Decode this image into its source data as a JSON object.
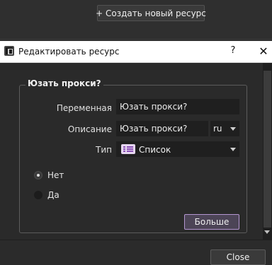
{
  "toolbar": {
    "create_resource_label": "+ Создать новый ресурс"
  },
  "dialog": {
    "title": "Редактировать ресурс",
    "help_glyph": "?",
    "close_glyph": "✕",
    "group_title": "Юзать прокси?",
    "variable_label": "Переменная",
    "variable_value": "Юзать прокси?",
    "description_label": "Описание",
    "description_value": "Юзать прокси?",
    "language_value": "ru",
    "type_label": "Тип",
    "type_value": "Список",
    "options": [
      {
        "label": "Нет",
        "selected": true
      },
      {
        "label": "Да",
        "selected": false
      }
    ],
    "more_button": "Больше"
  },
  "footer": {
    "close_button": "Close"
  },
  "colors": {
    "accent_border": "#b496d1",
    "accent_bg": "#4c4456",
    "dark_bg": "#2a2a2a",
    "field_bg": "#1f1f1f"
  },
  "icons": {
    "app": "app-icon",
    "type": "list-icon"
  }
}
